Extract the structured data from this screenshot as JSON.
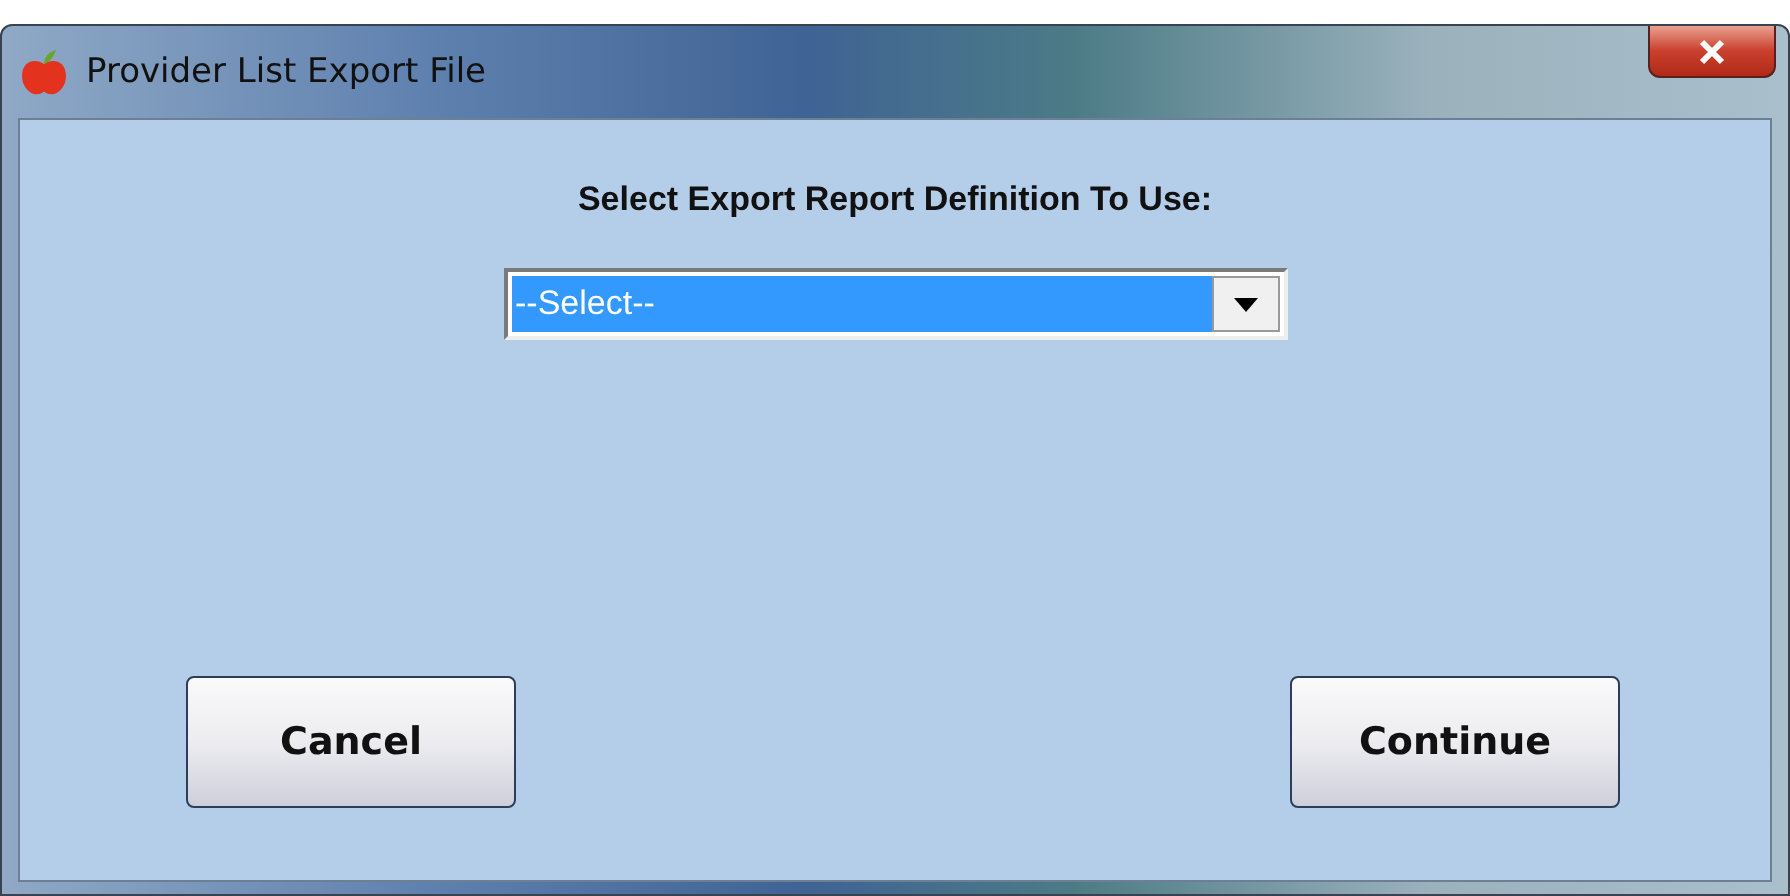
{
  "window": {
    "title": "Provider List Export File"
  },
  "heading": "Select Export Report Definition To Use:",
  "dropdown": {
    "value": "--Select--"
  },
  "buttons": [
    {
      "label": "Cancel"
    },
    {
      "label": "Continue"
    }
  ]
}
